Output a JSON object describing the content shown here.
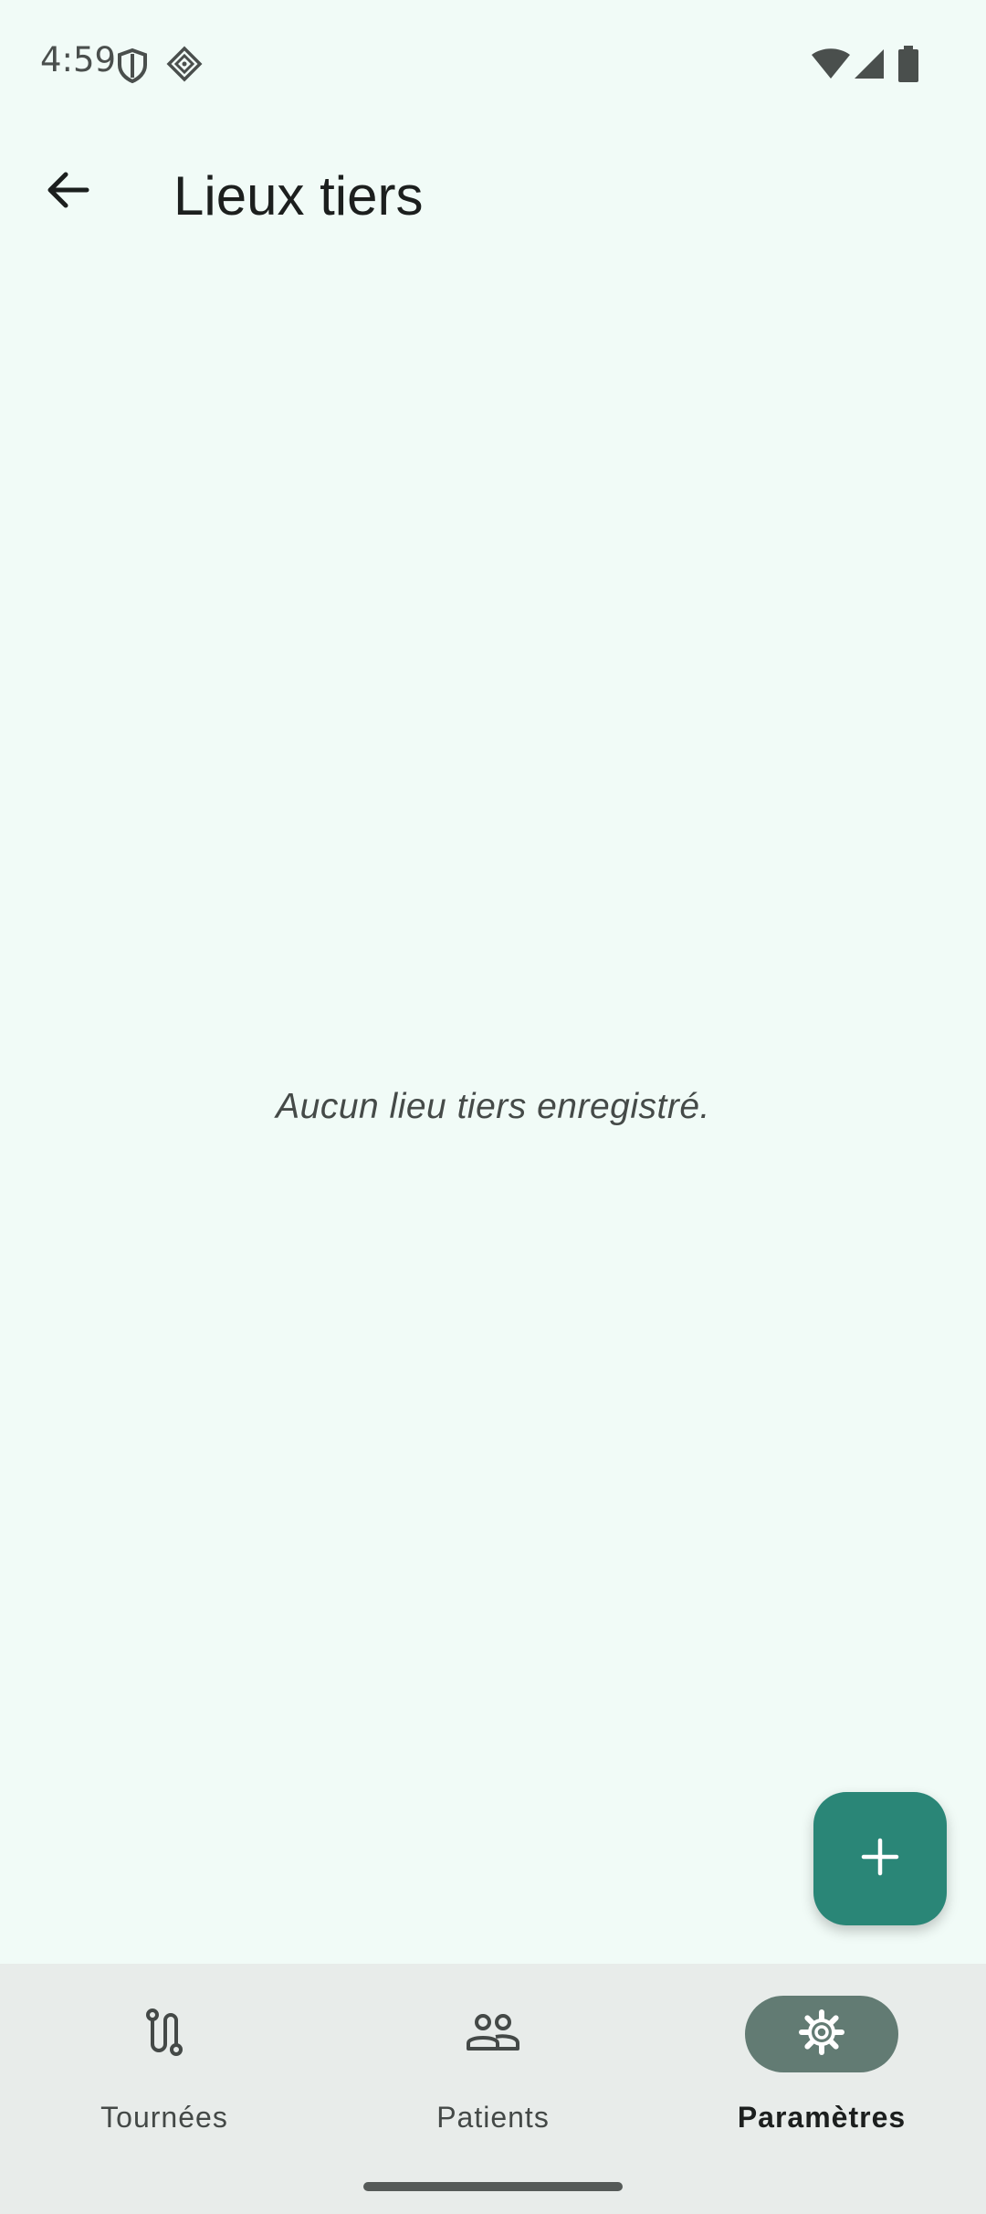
{
  "status_bar": {
    "time": "4:59",
    "left_icons": [
      "shield-icon",
      "grid-diamond-icon"
    ],
    "right_icons": [
      "wifi-icon",
      "signal-icon",
      "battery-icon"
    ]
  },
  "app_bar": {
    "back_icon": "arrow-back-icon",
    "title": "Lieux tiers"
  },
  "main": {
    "empty_message": "Aucun lieu tiers enregistré."
  },
  "fab": {
    "icon": "plus-icon"
  },
  "bottom_nav": {
    "items": [
      {
        "label": "Tournées",
        "icon": "route-icon",
        "active": false
      },
      {
        "label": "Patients",
        "icon": "people-icon",
        "active": false
      },
      {
        "label": "Paramètres",
        "icon": "gear-icon",
        "active": true
      }
    ]
  },
  "colors": {
    "background": "#f1fbf7",
    "fab": "#2a8677",
    "nav_background": "#e8ecea",
    "nav_active_pill": "#627b73"
  }
}
